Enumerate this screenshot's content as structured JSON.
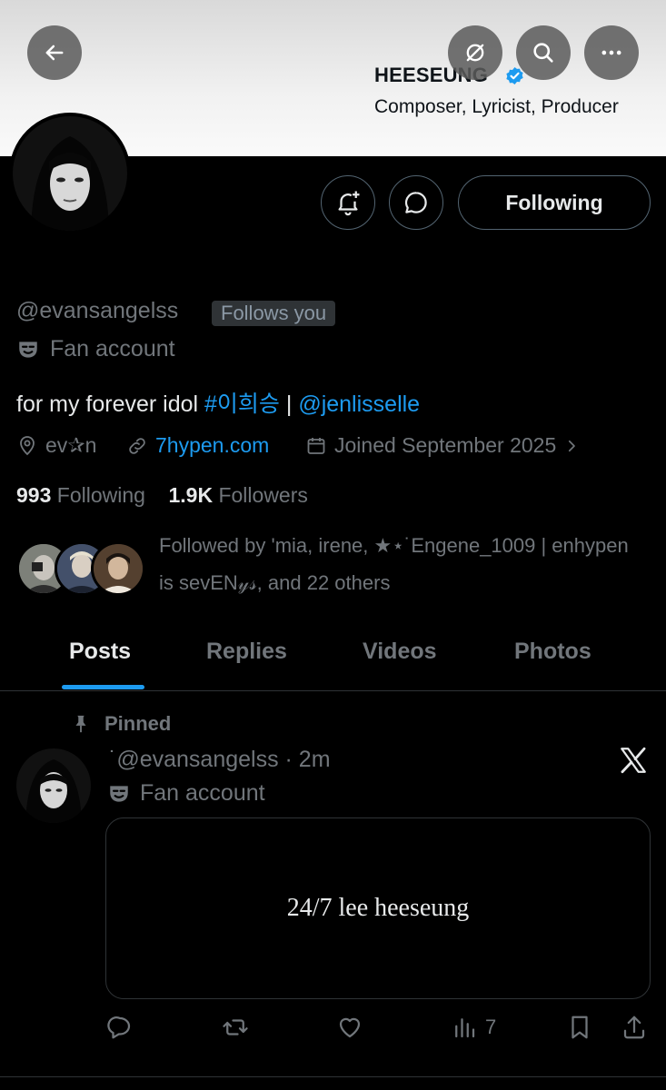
{
  "header": {
    "name": "HEESEUNG",
    "subtitle": "Composer, Lyricist, Producer",
    "icons": [
      "back-arrow-icon",
      "grok-icon",
      "search-icon",
      "more-icon"
    ]
  },
  "profile": {
    "handle": "@evansangelss",
    "follows_you": "Follows you",
    "fan_account": "Fan account",
    "bio_text": "for my forever idol ",
    "bio_hashtag": "#이희승",
    "bio_sep": " | ",
    "bio_mention": "@jenlisselle",
    "location": "ev✰n",
    "website": "7hypen.com",
    "joined": "Joined September 2025",
    "following_count": "993",
    "following_label": " Following",
    "followers_count": "1.9K",
    "followers_label": " Followers",
    "followed_by": "Followed by 'mia, irene, ★⋆˙Engene_1009 | enhypen is sevEN𝓎𝓈, and 22 others",
    "buttons": {
      "following_label": "Following"
    }
  },
  "tabs": [
    "Posts",
    "Replies",
    "Videos",
    "Photos"
  ],
  "active_tab": "Posts",
  "post": {
    "pinned_label": "Pinned",
    "handle_time": "˙@evansangelss · 2m",
    "fan_account": "Fan account",
    "card_text": "24/7 lee heeseung",
    "views": "7"
  },
  "colors": {
    "accent": "#1d9bf0",
    "muted": "#71767b",
    "text": "#e7e9ea",
    "border": "#2f3336",
    "background": "#000000"
  }
}
